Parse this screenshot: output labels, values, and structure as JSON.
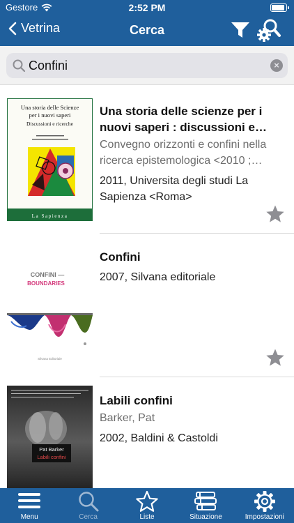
{
  "status_bar": {
    "carrier": "Gestore",
    "time": "2:52 PM"
  },
  "nav": {
    "back_label": "Vetrina",
    "title": "Cerca"
  },
  "search": {
    "value": "Confini",
    "placeholder": ""
  },
  "results": [
    {
      "title": "Una storia delle scienze per i nuovi saperi : discussioni e ricerche",
      "subtitle": "Convegno orizzonti e confini nella ricerca epistemologica <2010 ; Roma>",
      "publication": "2011, Universita degli studi La Sapienza <Roma>",
      "cover": {
        "line1": "Una storia delle Scienze",
        "line2": "per i nuovi saperi",
        "line3": "Discussioni e ricerche",
        "footer": "La Sapienza"
      }
    },
    {
      "title": "Confini",
      "subtitle": "",
      "publication": "2007, Silvana editoriale",
      "cover": {
        "line1": "CONFINI —",
        "line2": "BOUNDARIES"
      }
    },
    {
      "title": "Labili confini",
      "subtitle": "Barker, Pat",
      "publication": "2002, Baldini & Castoldi",
      "cover": {
        "author": "Pat Barker",
        "title": "Labili confini"
      }
    }
  ],
  "tabbar": {
    "items": [
      {
        "label": "Menu",
        "icon": "menu-icon"
      },
      {
        "label": "Cerca",
        "icon": "search-icon"
      },
      {
        "label": "Liste",
        "icon": "star-icon"
      },
      {
        "label": "Situazione",
        "icon": "books-icon"
      },
      {
        "label": "Impostazioni",
        "icon": "gear-icon"
      }
    ],
    "active": "Cerca"
  },
  "colors": {
    "bar": "#1f5f9c",
    "star": "#8e8e93",
    "active_tab": "#9fb8d3"
  }
}
